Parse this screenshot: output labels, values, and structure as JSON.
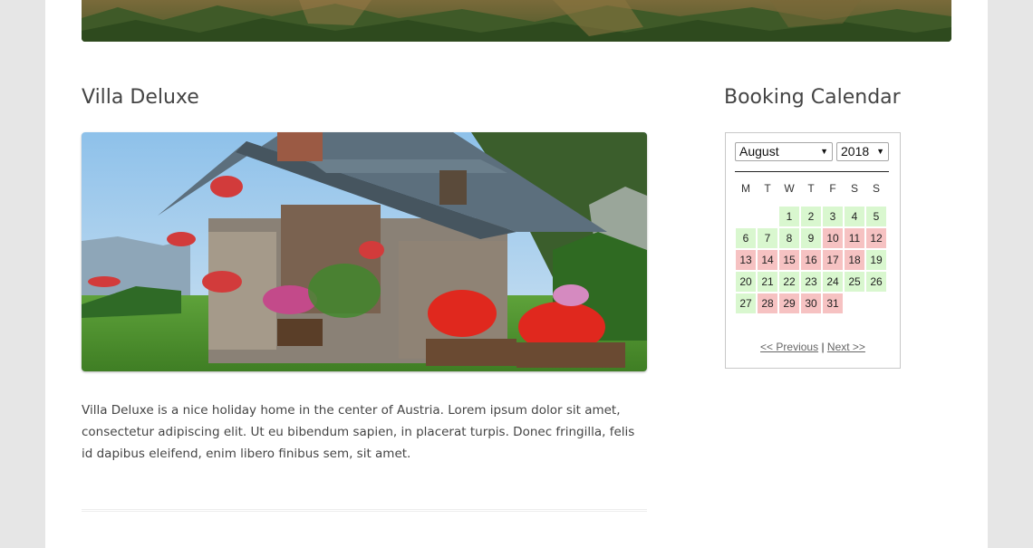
{
  "post": {
    "title": "Villa Deluxe",
    "body": "Villa Deluxe is a nice holiday home in the center of Austria. Lorem ipsum dolor sit amet, consectetur adipiscing elit. Ut eu bibendum sapien, in placerat turpis. Donec fringilla, felis id dapibus eleifend, enim libero finibus sem, sit amet."
  },
  "widget": {
    "title": "Booking Calendar"
  },
  "calendar": {
    "month": "August",
    "year": "2018",
    "weekdays": [
      "M",
      "T",
      "W",
      "T",
      "F",
      "S",
      "S"
    ],
    "first_weekday_index": 2,
    "days": [
      {
        "d": "1",
        "status": "available"
      },
      {
        "d": "2",
        "status": "available"
      },
      {
        "d": "3",
        "status": "available"
      },
      {
        "d": "4",
        "status": "available"
      },
      {
        "d": "5",
        "status": "available"
      },
      {
        "d": "6",
        "status": "available"
      },
      {
        "d": "7",
        "status": "available"
      },
      {
        "d": "8",
        "status": "available"
      },
      {
        "d": "9",
        "status": "available"
      },
      {
        "d": "10",
        "status": "booked"
      },
      {
        "d": "11",
        "status": "booked"
      },
      {
        "d": "12",
        "status": "booked"
      },
      {
        "d": "13",
        "status": "booked"
      },
      {
        "d": "14",
        "status": "booked"
      },
      {
        "d": "15",
        "status": "booked"
      },
      {
        "d": "16",
        "status": "booked"
      },
      {
        "d": "17",
        "status": "booked"
      },
      {
        "d": "18",
        "status": "booked"
      },
      {
        "d": "19",
        "status": "available"
      },
      {
        "d": "20",
        "status": "available"
      },
      {
        "d": "21",
        "status": "available"
      },
      {
        "d": "22",
        "status": "available"
      },
      {
        "d": "23",
        "status": "available"
      },
      {
        "d": "24",
        "status": "available"
      },
      {
        "d": "25",
        "status": "available"
      },
      {
        "d": "26",
        "status": "available"
      },
      {
        "d": "27",
        "status": "available"
      },
      {
        "d": "28",
        "status": "booked"
      },
      {
        "d": "29",
        "status": "booked"
      },
      {
        "d": "30",
        "status": "booked"
      },
      {
        "d": "31",
        "status": "booked"
      }
    ],
    "prev_label": "<< Previous",
    "separator": "|",
    "next_label": "Next >>"
  },
  "colors": {
    "available": "#d9f7cf",
    "booked": "#f6c2c2",
    "text": "#444444"
  }
}
